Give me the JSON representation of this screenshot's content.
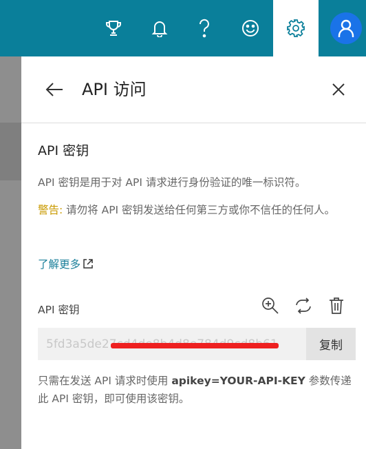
{
  "topbar": {
    "icons": [
      "trophy-icon",
      "bell-icon",
      "help-icon",
      "smiley-icon",
      "gear-icon",
      "user-avatar-icon"
    ]
  },
  "panel": {
    "title": "API 访问"
  },
  "section": {
    "title": "API 密钥",
    "description": "API 密钥是用于对 API 请求进行身份验证的唯一标识符。",
    "warning_label": "警告:",
    "warning_text": " 请勿将 API 密钥发送给任何第三方或你不信任的任何人。",
    "learn_more": "了解更多"
  },
  "api_key": {
    "label": "API 密钥",
    "value": "5fd3a5de27cd4de8b4d8e784d9cd8b61",
    "copy_label": "复制"
  },
  "note": {
    "prefix": "只需在发送 API 请求时使用 ",
    "param": "apikey=YOUR-API-KEY",
    "suffix": " 参数传递此 API 密钥，即可使用该密钥。"
  },
  "colors": {
    "topbar": "#0a7f9a",
    "avatar": "#1a73e8",
    "warning": "#c99a00",
    "link": "#1a7f9a"
  }
}
